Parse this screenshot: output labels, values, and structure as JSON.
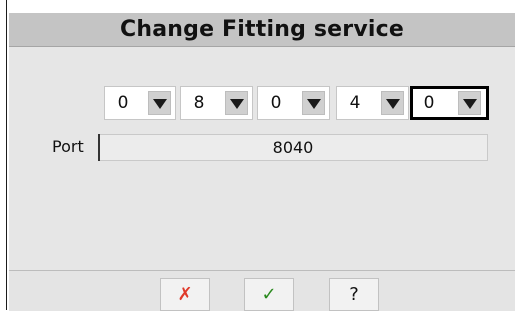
{
  "dialog": {
    "title": "Change Fitting service"
  },
  "digits": [
    {
      "value": "0",
      "focused": false
    },
    {
      "value": "8",
      "focused": false
    },
    {
      "value": "0",
      "focused": false
    },
    {
      "value": "4",
      "focused": false
    },
    {
      "value": "0",
      "focused": true
    }
  ],
  "port": {
    "label": "Port",
    "value": "8040"
  },
  "buttons": {
    "cancel": {
      "glyph": "✗",
      "icon": "cancel-x-icon",
      "color": "#e03a2a"
    },
    "ok": {
      "glyph": "✓",
      "icon": "checkmark-icon",
      "color": "#2a8a1e"
    },
    "help": {
      "glyph": "?",
      "icon": "help-icon"
    }
  }
}
